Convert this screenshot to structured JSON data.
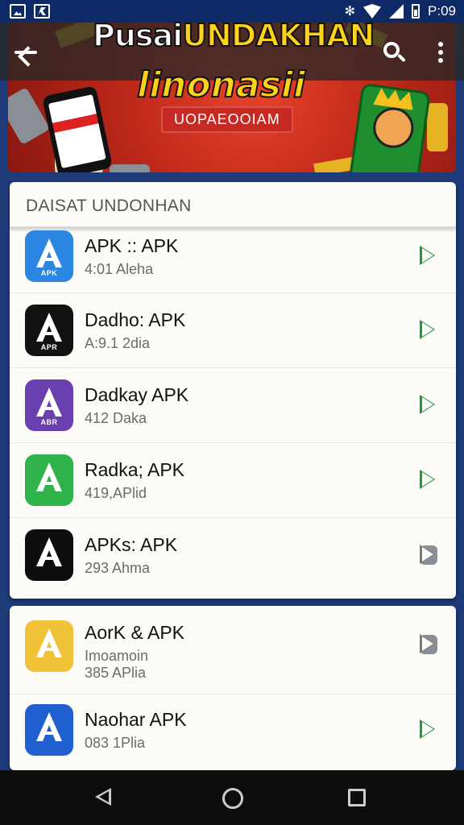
{
  "status_bar": {
    "time": "P:09",
    "icons": [
      "image-icon",
      "app-icon",
      "bluetooth-icon",
      "wifi-icon",
      "signal-icon",
      "battery-icon"
    ]
  },
  "banner": {
    "title_white": "Pusai",
    "title_yellow": "UNDAKHAN",
    "subtitle": "linonasii",
    "tag": "UOPAEOOIAM"
  },
  "section": {
    "header": "DAISAT UNDONHAN"
  },
  "apps_main": [
    {
      "title": "APK :: APK",
      "meta": "4:01 Aleha",
      "icon_label": "APK",
      "icon_color": "#2a86e0",
      "play": "green"
    },
    {
      "title": "Dadho: APK",
      "meta": "A:9.1 2dia",
      "icon_label": "APR",
      "icon_color": "#111111",
      "play": "green"
    },
    {
      "title": "Dadkay APK",
      "meta": "412 Daka",
      "icon_label": "ABR",
      "icon_color": "#6a3fb0",
      "play": "green"
    },
    {
      "title": "Radka; APK",
      "meta": "419,APlid",
      "icon_label": "",
      "icon_color": "#2fb34a",
      "play": "green"
    },
    {
      "title": "APKs: APK",
      "meta": "293 Ahma",
      "icon_label": "",
      "icon_color": "#0e0e0e",
      "play": "grey"
    }
  ],
  "apps_second": [
    {
      "title": "AorK & APK",
      "meta_line1": "Imoamoin",
      "meta": "385 APlia",
      "icon_label": "",
      "icon_color": "#f0c238",
      "play": "grey"
    },
    {
      "title": "Naohar APK",
      "meta": "083 1Plia",
      "icon_label": "",
      "icon_color": "#1f5fd0",
      "play": "green"
    }
  ],
  "colors": {
    "accent_green": "#1f9a3a",
    "app_bar": "#282828",
    "page_bg": "#1f3a78"
  }
}
